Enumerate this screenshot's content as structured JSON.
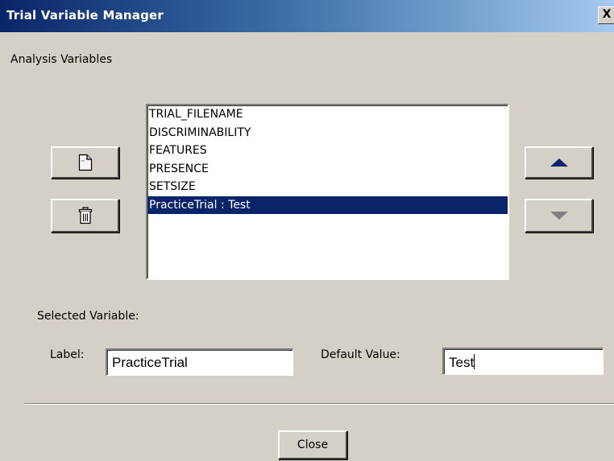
{
  "window": {
    "title": "Trial Variable Manager",
    "close_glyph": "X"
  },
  "section_label": "Analysis Variables",
  "variables": [
    "TRIAL_FILENAME",
    "DISCRIMINABILITY",
    "FEATURES",
    "PRESENCE",
    "SETSIZE",
    "PracticeTrial : Test"
  ],
  "selected_index": 5,
  "icons": {
    "add": "new-document-icon",
    "delete": "trash-icon",
    "up": "arrow-up-icon",
    "down": "arrow-down-icon"
  },
  "selected_variable": {
    "heading": "Selected Variable:",
    "label_caption": "Label:",
    "label_value": "PracticeTrial",
    "default_caption": "Default Value:",
    "default_value": "Test"
  },
  "buttons": {
    "close_label": "Close"
  },
  "colors": {
    "title_bar": "#0a246a",
    "selection": "#0a246a",
    "dialog_bg": "#d4d0c8",
    "arrow_up": "#0a246a",
    "arrow_down_disabled": "#808080"
  }
}
